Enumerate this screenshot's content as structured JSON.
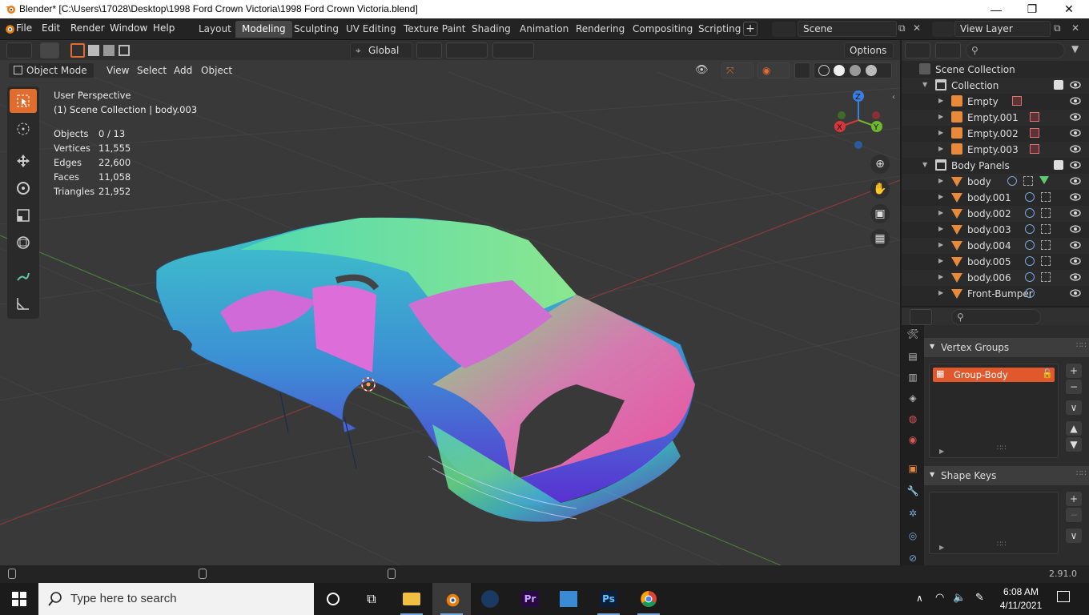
{
  "window": {
    "title": "Blender* [C:\\Users\\17028\\Desktop\\1998 Ford Crown Victoria\\1998 Ford Crown Victoria.blend]",
    "minimize": "—",
    "maximize": "❐",
    "close": "✕"
  },
  "menu": [
    "File",
    "Edit",
    "Render",
    "Window",
    "Help"
  ],
  "workspaces": [
    {
      "label": "Layout",
      "active": false
    },
    {
      "label": "Modeling",
      "active": true
    },
    {
      "label": "Sculpting",
      "active": false
    },
    {
      "label": "UV Editing",
      "active": false
    },
    {
      "label": "Texture Paint",
      "active": false
    },
    {
      "label": "Shading",
      "active": false
    },
    {
      "label": "Animation",
      "active": false
    },
    {
      "label": "Rendering",
      "active": false
    },
    {
      "label": "Compositing",
      "active": false
    },
    {
      "label": "Scripting",
      "active": false
    }
  ],
  "scene": {
    "name": "Scene",
    "view_layer": "View Layer"
  },
  "viewport": {
    "transform_orientation": "Global",
    "options_label": "Options",
    "mode": "Object Mode",
    "header_menu": [
      "View",
      "Select",
      "Add",
      "Object"
    ],
    "perspective": "User Perspective",
    "context": "(1) Scene Collection | body.003",
    "stats": [
      {
        "label": "Objects",
        "value": "0 / 13"
      },
      {
        "label": "Vertices",
        "value": "11,555"
      },
      {
        "label": "Edges",
        "value": "22,600"
      },
      {
        "label": "Faces",
        "value": "11,058"
      },
      {
        "label": "Triangles",
        "value": "21,952"
      }
    ],
    "gizmo_axes": {
      "x": "X",
      "y": "Y",
      "z": "Z"
    }
  },
  "outliner": {
    "root": "Scene Collection",
    "rows": [
      {
        "name": "Collection",
        "type": "collection"
      },
      {
        "name": "Empty",
        "type": "empty"
      },
      {
        "name": "Empty.001",
        "type": "empty"
      },
      {
        "name": "Empty.002",
        "type": "empty"
      },
      {
        "name": "Empty.003",
        "type": "empty"
      },
      {
        "name": "Body Panels",
        "type": "collection"
      },
      {
        "name": "body",
        "type": "mesh"
      },
      {
        "name": "body.001",
        "type": "mesh"
      },
      {
        "name": "body.002",
        "type": "mesh"
      },
      {
        "name": "body.003",
        "type": "mesh"
      },
      {
        "name": "body.004",
        "type": "mesh"
      },
      {
        "name": "body.005",
        "type": "mesh"
      },
      {
        "name": "body.006",
        "type": "mesh"
      },
      {
        "name": "Front-Bumper",
        "type": "mesh"
      }
    ]
  },
  "properties": {
    "vertex_groups_title": "Vertex Groups",
    "vertex_group_item": "Group-Body",
    "shape_keys_title": "Shape Keys",
    "add": "+",
    "remove": "−",
    "more": "∨"
  },
  "statusbar": {
    "version": "2.91.0"
  },
  "taskbar": {
    "search_placeholder": "Type here to search",
    "time": "6:08 AM",
    "date": "4/11/2021"
  },
  "colors": {
    "accent": "#e06d2e",
    "workspace_active": "#474747",
    "vertex_group_selected": "#e0582b"
  }
}
